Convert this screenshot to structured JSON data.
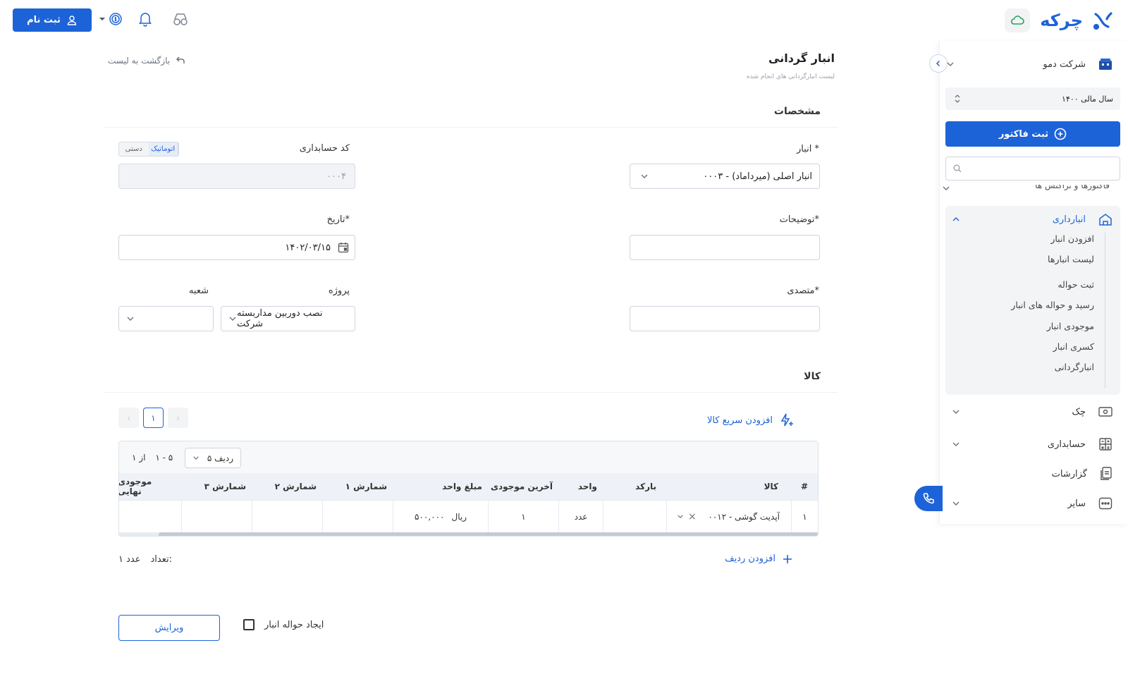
{
  "header": {
    "signup_label": "ثبت نام",
    "logo_text": "چرکه",
    "icons": [
      "user-icon",
      "coin-icon",
      "bell-icon",
      "glasses-icon",
      "cloud-icon"
    ]
  },
  "sidebar": {
    "company": "شرکت دمو",
    "fiscal_year": "سال مالی ۱۴۰۰",
    "invoice_button": "ثبت فاکتور",
    "search_placeholder": "",
    "clipped_item": "فاکتورها و تراکنش ها",
    "warehouse": {
      "label": "انبارداری",
      "items": [
        "افزودن انبار",
        "لیست انبارها",
        "ثبت حواله",
        "رسید و حواله های انبار",
        "موجودی انبار",
        "کسری انبار",
        "انبارگردانی"
      ]
    },
    "items": [
      {
        "label": "چک",
        "icon": "cheque-icon"
      },
      {
        "label": "حسابداری",
        "icon": "calculator-icon"
      },
      {
        "label": "گزارشات",
        "icon": "report-icon"
      },
      {
        "label": "سایر",
        "icon": "more-icon"
      }
    ],
    "accent_color": "#1d63d8"
  },
  "page": {
    "title": "انبار گردانی",
    "subtitle": "لیست انبارگردانی های انجام شده",
    "back_label": "بازگشت به لیست"
  },
  "form": {
    "section_title": "مشخصات",
    "warehouse_label": "انبار *",
    "warehouse_value": "۰۰۰۳ - انبار اصلی (میرداماد)",
    "code_label": "کد حسابداری",
    "code_mode_auto": "اتوماتیک",
    "code_mode_manual": "دستی",
    "code_value": "۰۰۰۴",
    "description_label": "توضیحات*",
    "description_value": "",
    "date_label": "تاریخ*",
    "date_value": "۱۴۰۲/۰۳/۱۵",
    "responsible_label": "متصدی*",
    "responsible_value": "",
    "project_label": "پروژه",
    "project_value": "نصب دوربین مداربسته شرکت",
    "branch_label": "شعبه",
    "branch_value": ""
  },
  "goods": {
    "section_title": "کالا",
    "quick_add": "افزودن سریع کالا",
    "pages": [
      "۱"
    ],
    "rows_per_page": "۵ ردیف",
    "range": "۱ - ۵",
    "of": "از ۱",
    "columns": [
      "#",
      "کالا",
      "بارکد",
      "واحد",
      "آخرین موجودی",
      "مبلغ واحد",
      "شمارش ۱",
      "شمارش ۲",
      "شمارش ۳",
      "موجودی نهایی"
    ],
    "rows": [
      {
        "num": "۱",
        "item": "۰۰۱۲ - آپدیت گوشی",
        "barcode": "",
        "unit": "عدد",
        "last_stock": "۱",
        "unit_price": "۵۰۰,۰۰۰",
        "currency": "ریال",
        "count1": "",
        "count2": "",
        "count3": "",
        "final": ""
      }
    ],
    "add_row": "افزودن ردیف",
    "count_label": "تعداد:",
    "count_value": "۱ عدد"
  },
  "footer": {
    "create_transfer_label": "ایجاد حواله انبار",
    "edit_button": "ویرایش"
  }
}
